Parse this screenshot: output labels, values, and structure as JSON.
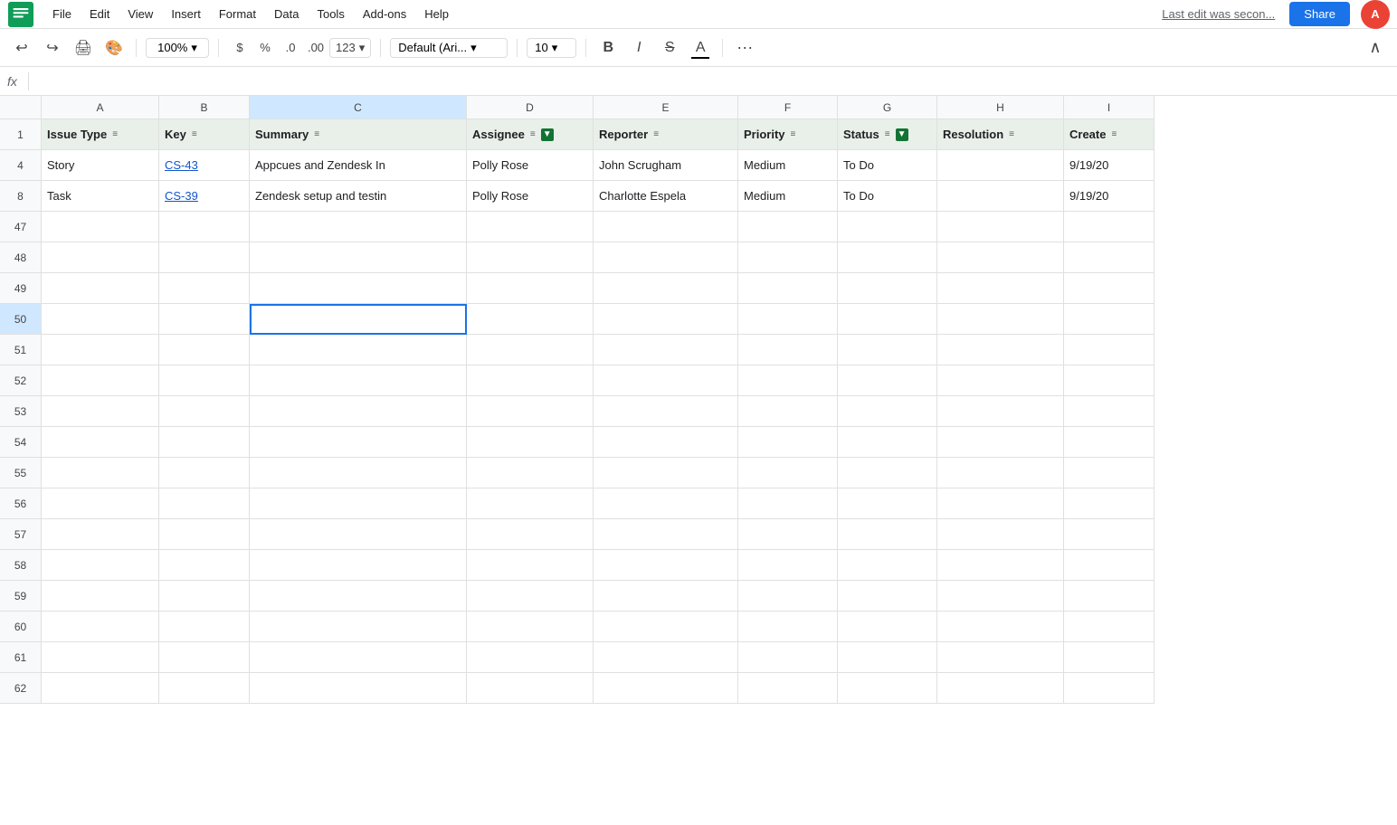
{
  "app": {
    "logo_color": "#0f9d58",
    "title": "Google Sheets"
  },
  "menubar": {
    "items": [
      "File",
      "Edit",
      "View",
      "Insert",
      "Format",
      "Data",
      "Tools",
      "Add-ons",
      "Help"
    ],
    "last_edit": "Last edit was secon...",
    "share_label": "Share"
  },
  "toolbar": {
    "zoom": "100%",
    "currency": "$",
    "percent": "%",
    "decimal_less": ".0",
    "decimal_more": ".00",
    "format_123": "123",
    "font": "Default (Ari...",
    "font_size": "10",
    "bold": "B",
    "italic": "I",
    "strikethrough": "S",
    "underline": "A",
    "more": "···",
    "collapse": "∧"
  },
  "formula_bar": {
    "label": "fx"
  },
  "columns": [
    {
      "id": "A",
      "label": "A",
      "class": "col-a"
    },
    {
      "id": "B",
      "label": "B",
      "class": "col-b"
    },
    {
      "id": "C",
      "label": "C",
      "class": "col-c"
    },
    {
      "id": "D",
      "label": "D",
      "class": "col-d"
    },
    {
      "id": "E",
      "label": "E",
      "class": "col-e"
    },
    {
      "id": "F",
      "label": "F",
      "class": "col-f"
    },
    {
      "id": "G",
      "label": "G",
      "class": "col-g"
    },
    {
      "id": "H",
      "label": "H",
      "class": "col-h"
    },
    {
      "id": "I",
      "label": "I",
      "class": "col-i"
    }
  ],
  "rows": [
    {
      "num": "1",
      "is_header": true,
      "cells": [
        {
          "text": "Issue Type",
          "has_sort": true,
          "class": "col-a"
        },
        {
          "text": "Key",
          "has_sort": true,
          "class": "col-b"
        },
        {
          "text": "Summary",
          "has_sort": true,
          "class": "col-c"
        },
        {
          "text": "Assignee",
          "has_sort": true,
          "has_filter": true,
          "class": "col-d"
        },
        {
          "text": "Reporter",
          "has_sort": true,
          "class": "col-e"
        },
        {
          "text": "Priority",
          "has_sort": true,
          "class": "col-f"
        },
        {
          "text": "Status",
          "has_sort": true,
          "has_filter": true,
          "class": "col-g"
        },
        {
          "text": "Resolution",
          "has_sort": true,
          "class": "col-h"
        },
        {
          "text": "Create",
          "has_sort": true,
          "class": "col-i"
        }
      ]
    },
    {
      "num": "4",
      "cells": [
        {
          "text": "Story",
          "class": "col-a"
        },
        {
          "text": "CS-43",
          "is_link": true,
          "class": "col-b"
        },
        {
          "text": "Appcues and Zendesk In",
          "class": "col-c"
        },
        {
          "text": "Polly Rose",
          "class": "col-d"
        },
        {
          "text": "John Scrugham",
          "class": "col-e"
        },
        {
          "text": "Medium",
          "class": "col-f"
        },
        {
          "text": "To Do",
          "class": "col-g"
        },
        {
          "text": "",
          "class": "col-h"
        },
        {
          "text": "9/19/20",
          "class": "col-i"
        }
      ]
    },
    {
      "num": "8",
      "cells": [
        {
          "text": "Task",
          "class": "col-a"
        },
        {
          "text": "CS-39",
          "is_link": true,
          "class": "col-b"
        },
        {
          "text": "Zendesk setup and testin",
          "class": "col-c"
        },
        {
          "text": "Polly Rose",
          "class": "col-d"
        },
        {
          "text": "Charlotte Espela",
          "class": "col-e"
        },
        {
          "text": "Medium",
          "class": "col-f"
        },
        {
          "text": "To Do",
          "class": "col-g"
        },
        {
          "text": "",
          "class": "col-h"
        },
        {
          "text": "9/19/20",
          "class": "col-i"
        }
      ]
    }
  ],
  "empty_rows": [
    "47",
    "48",
    "49",
    "50",
    "51",
    "52",
    "53",
    "54",
    "55",
    "56",
    "57",
    "58",
    "59",
    "60",
    "61",
    "62"
  ],
  "selected_cell": {
    "row": "50",
    "col": "C"
  },
  "colors": {
    "header_bg": "#e8f0e9",
    "selected_border": "#1a73e8",
    "link": "#1155cc",
    "filter_bg": "#137333",
    "row_bg": "#f8f9fa"
  }
}
